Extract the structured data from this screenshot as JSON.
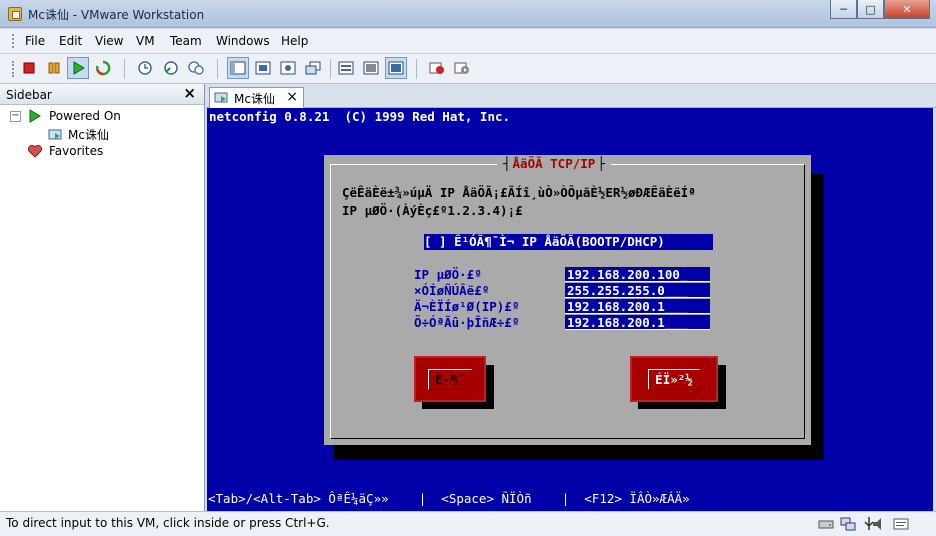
{
  "window": {
    "title": "Mc诛仙 - VMware Workstation",
    "buttons": {
      "minimize": "─",
      "maximize": "□",
      "close": "✕"
    }
  },
  "menu": [
    "File",
    "Edit",
    "View",
    "VM",
    "Team",
    "Windows",
    "Help"
  ],
  "toolbar": {
    "icons": [
      "stop-icon",
      "pause-icon",
      "play-icon",
      "reset-icon",
      "snapshot-icon",
      "revert-snapshot-icon",
      "snapshot-manager-icon",
      "quick-switch-icon",
      "fullscreen-icon",
      "unity-icon",
      "summary-icon",
      "console-view-icon",
      "appliance-view-icon",
      "record-icon",
      "replay-icon"
    ]
  },
  "sidebar": {
    "title": "Sidebar",
    "close": "×",
    "tree": {
      "group_toggle": "−",
      "group_label": "Powered On",
      "vm_label": "Mc诛仙",
      "favorites_label": "Favorites"
    }
  },
  "tab": {
    "label": "Mc诛仙",
    "close": "×"
  },
  "console": {
    "header": "netconfig 0.8.21  (C) 1999 Red Hat, Inc.",
    "dialog_title": "ÅäÖÃ TCP/IP",
    "intro_line1": "ÇëÊäÈë±¾»úµÄ IP ÅäÖÃ¡£ÃÍî¸ùÒ»ÒÔµãÈ½ER½øÐÆÊäÈëÍª",
    "intro_line2": "IP µØÖ·(ÀýÈç£º1.2.3.4)¡£",
    "dhcp_checkbox": "[ ] Ê¹ÓÃ¶¯Ì¬ IP ÅäÖÃ(BOOTP/DHCP)",
    "fields": [
      {
        "label": "IP µØÖ·£º",
        "value": "192.168.200.100_"
      },
      {
        "label": "×ÓÍøÑÚÂë£º",
        "value": "255.255.255.0___"
      },
      {
        "label": "Ä¬ÈÏÍø¹Ø(IP)£º",
        "value": "192.168.200.1___"
      },
      {
        "label": "Ö÷ÓªÃû·þÎñÆ÷£º",
        "value": "192.168.200.1___"
      }
    ],
    "ok_button": "È·¶¨",
    "cancel_button": "ÉÏ»²½",
    "help_line": "<Tab>/<Alt-Tab> ÔªÊ¼äÇ»»    |  <Space> ÑÏÒñ    |  <F12> ÏÂÒ»ÆÁÄ»"
  },
  "status": {
    "text": "To direct input to this VM, click inside or press Ctrl+G.",
    "icons": [
      "hard-disk-icon",
      "network-icon",
      "usb-icon",
      "sound-icon",
      "message-icon"
    ]
  }
}
